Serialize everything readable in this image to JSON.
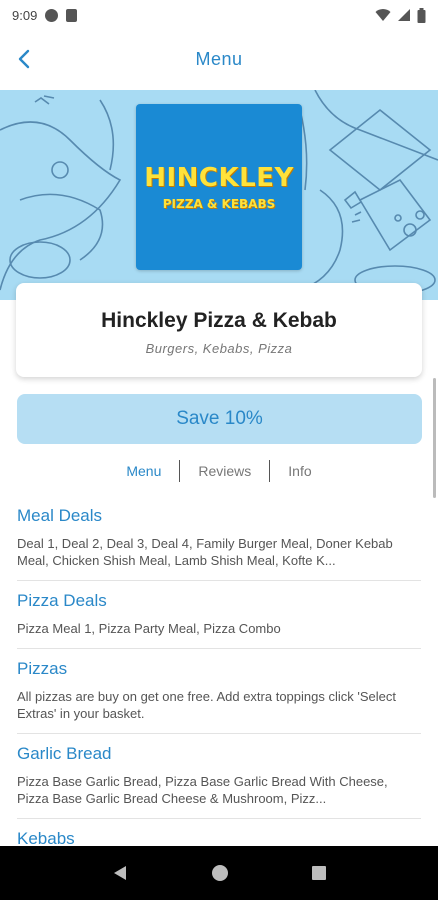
{
  "status_bar": {
    "time": "9:09"
  },
  "app_bar": {
    "title": "Menu"
  },
  "logo": {
    "line1": "HINCKLEY",
    "line2": "PIZZA & KEBABS"
  },
  "restaurant": {
    "name": "Hinckley Pizza & Kebab",
    "cuisine": "Burgers, Kebabs, Pizza"
  },
  "offer": {
    "label": "Save 10%"
  },
  "tabs": [
    {
      "label": "Menu",
      "active": true
    },
    {
      "label": "Reviews"
    },
    {
      "label": "Info"
    }
  ],
  "categories": [
    {
      "title": "Meal Deals",
      "desc": "Deal 1, Deal 2, Deal 3, Deal 4, Family Burger Meal, Doner Kebab Meal, Chicken Shish Meal, Lamb Shish Meal, Kofte K..."
    },
    {
      "title": "Pizza Deals",
      "desc": "Pizza Meal 1, Pizza Party Meal, Pizza Combo"
    },
    {
      "title": "Pizzas",
      "desc": "All pizzas are buy on get one free. Add extra toppings click 'Select Extras' in your basket."
    },
    {
      "title": "Garlic Bread",
      "desc": "Pizza Base Garlic Bread, Pizza Base Garlic Bread With Cheese, Pizza Base Garlic Bread Cheese & Mushroom, Pizz..."
    },
    {
      "title": "Kebabs",
      "desc": ""
    }
  ],
  "colors": {
    "accent": "#2a88c8",
    "hero_bg": "#a8dbf3",
    "save_bg": "#b6def3",
    "logo_bg": "#1a8ad4",
    "logo_text": "#ffe23a"
  }
}
